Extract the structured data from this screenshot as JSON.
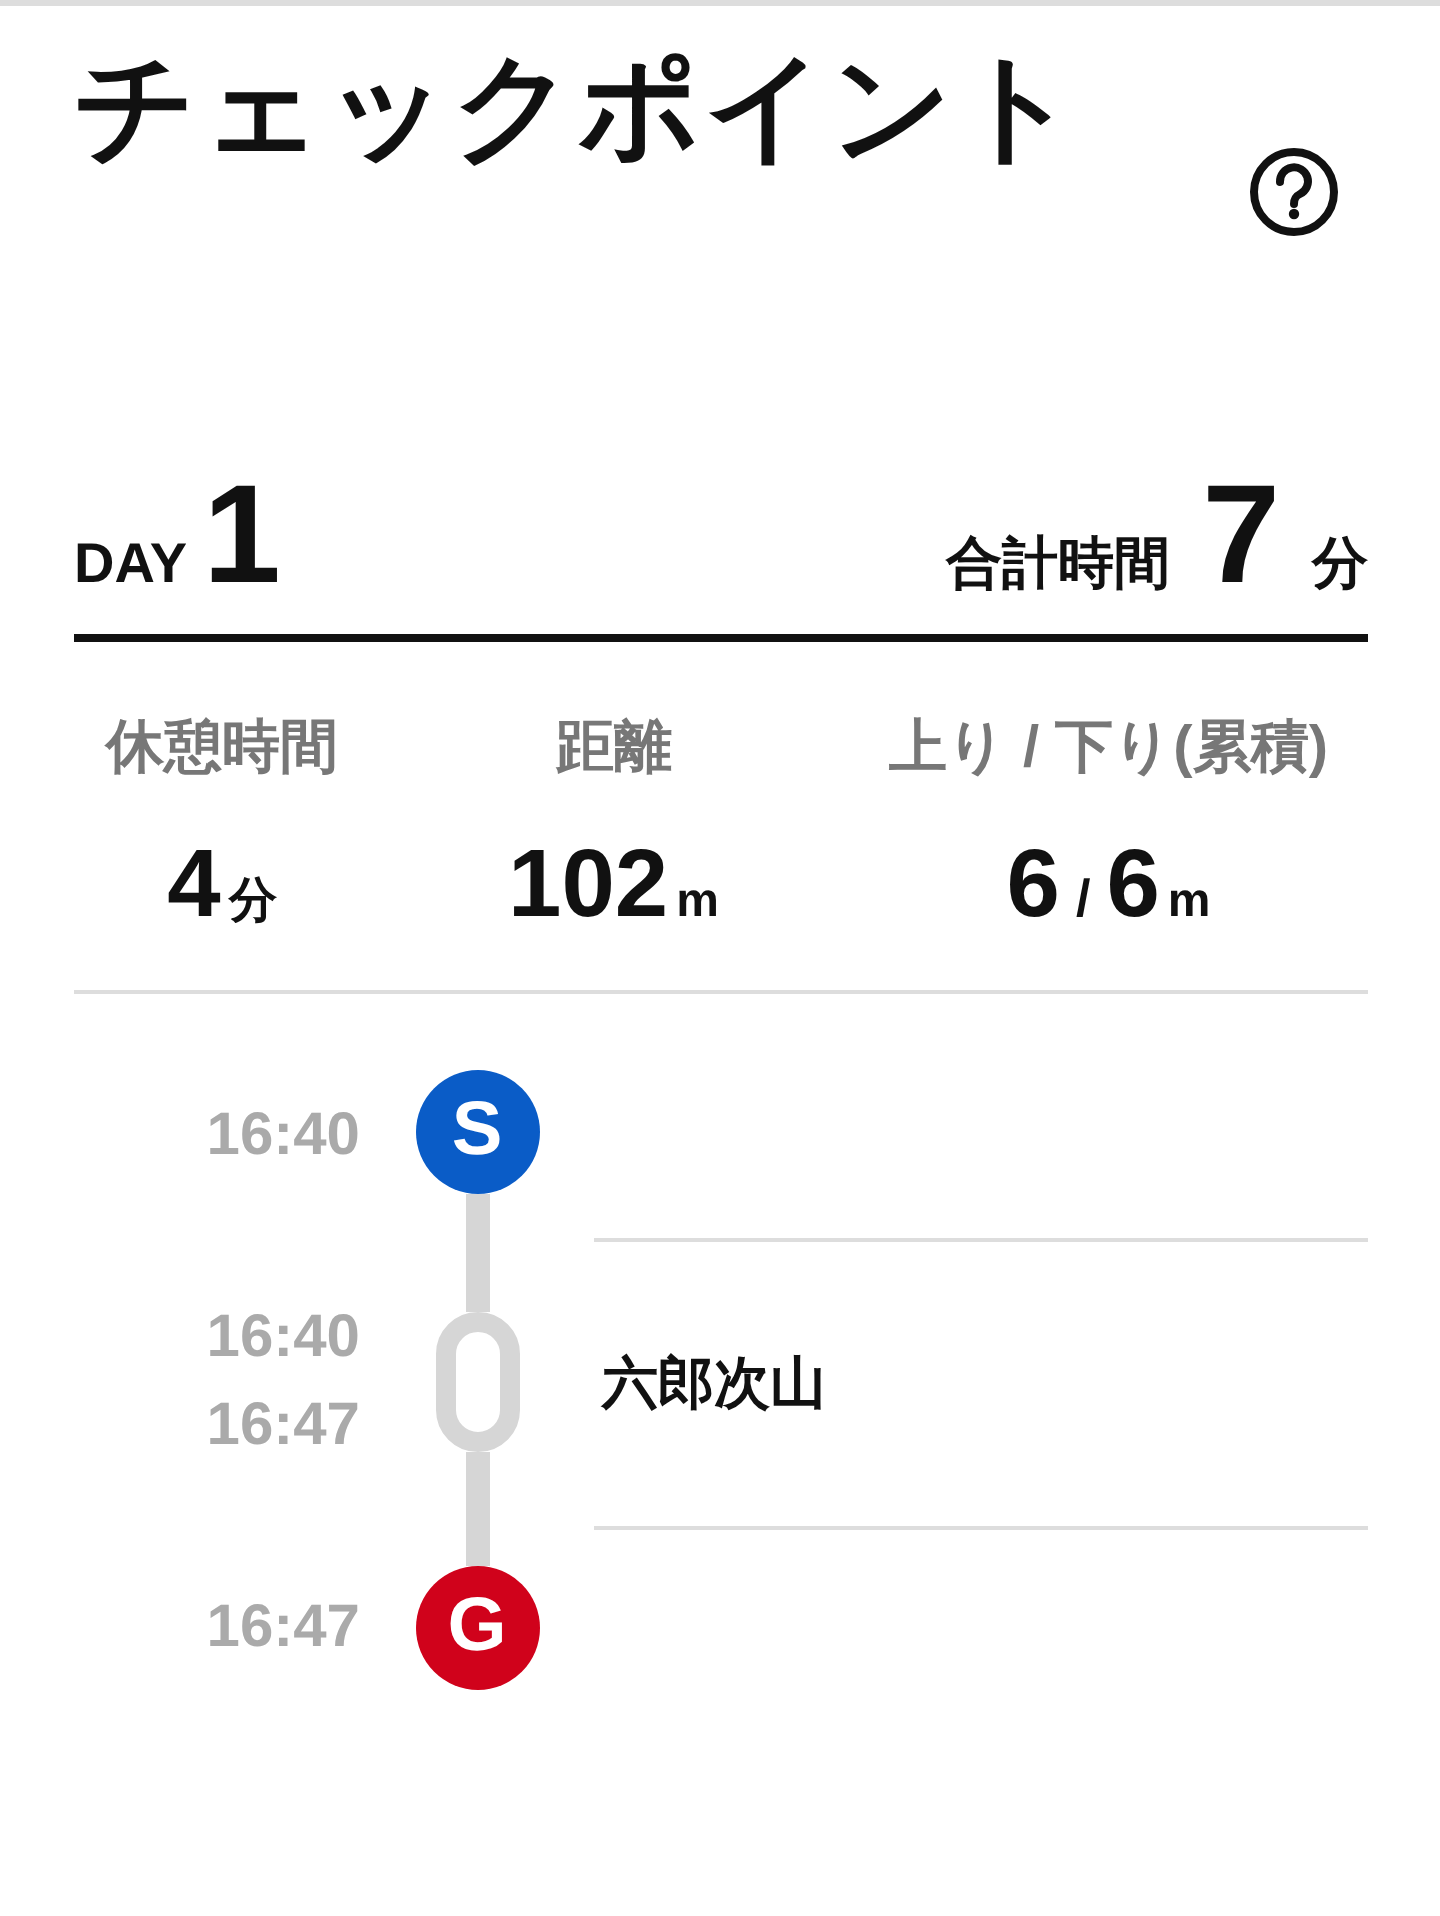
{
  "header": {
    "title": "チェックポイント"
  },
  "summary": {
    "day_label": "DAY",
    "day_number": "1",
    "total_label": "合計時間",
    "total_value": "7",
    "total_unit": "分"
  },
  "stats": [
    {
      "label": "休憩時間",
      "value": "4",
      "unit": "分"
    },
    {
      "label": "距離",
      "value": "102",
      "unit": "m"
    },
    {
      "label": "上り / 下り(累積)",
      "value": "6",
      "separator": "/",
      "value_2": "6",
      "unit": "m"
    }
  ],
  "timeline": [
    {
      "kind": "start",
      "marker": "S",
      "color": "#0a5cc7",
      "times": [
        "16:40"
      ]
    },
    {
      "kind": "checkpoint",
      "name": "六郎次山",
      "times": [
        "16:40",
        "16:47"
      ]
    },
    {
      "kind": "goal",
      "marker": "G",
      "color": "#d0021b",
      "times": [
        "16:47"
      ]
    }
  ]
}
